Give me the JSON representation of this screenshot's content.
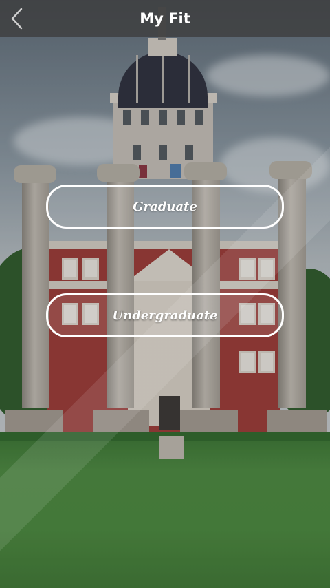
{
  "header": {
    "title": "My Fit",
    "back_icon": "chevron-left-icon"
  },
  "options": [
    {
      "label": "Graduate"
    },
    {
      "label": "Undergraduate"
    }
  ],
  "colors": {
    "header_bg": "#3c3c3c",
    "button_border": "#ffffff",
    "text": "#ffffff"
  }
}
